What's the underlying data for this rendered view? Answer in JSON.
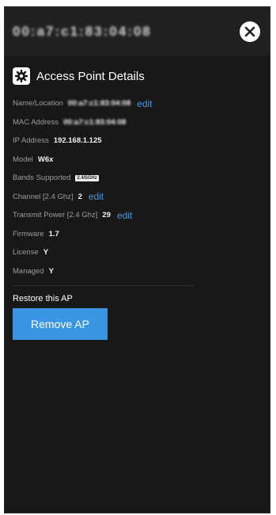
{
  "header": {
    "title": "00:a7:c1:83:04:08"
  },
  "section": {
    "title": "Access Point Details"
  },
  "rows": [
    {
      "label": "Name/Location",
      "value": "00:a7:c1:83:04:08",
      "edit": "edit"
    },
    {
      "label": "MAC Address",
      "value": "00:a7:c1:83:04:08"
    },
    {
      "label": "IP Address",
      "value": "192.168.1.125"
    },
    {
      "label": "Model",
      "value": "W6x"
    },
    {
      "label": "Bands Supported",
      "badge": "2.4/5GHz"
    },
    {
      "label": "Channel [2.4 Ghz]",
      "value": "2",
      "edit": "edit"
    },
    {
      "label": "Transmit Power [2.4 Ghz]",
      "value": "29",
      "edit": "edit"
    },
    {
      "label": "Firmware",
      "value": "1.7"
    },
    {
      "label": "License",
      "value": "Y"
    },
    {
      "label": "Managed",
      "value": "Y"
    }
  ],
  "restore": {
    "label": "Restore this AP"
  },
  "remove": {
    "button_label": "Remove AP"
  },
  "colors": {
    "accent": "#3a96e4",
    "link": "#3b9be8",
    "panel": "#181818"
  },
  "icons": {
    "close": "close-icon",
    "settings": "gear-icon"
  }
}
